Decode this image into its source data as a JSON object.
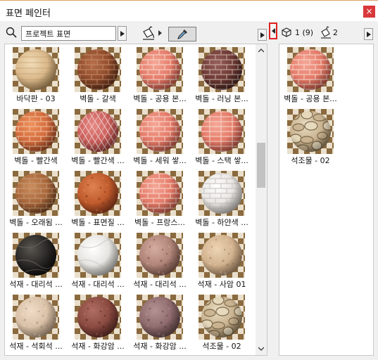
{
  "window": {
    "title": "표면 페인터",
    "close_glyph": "×"
  },
  "search": {
    "value": "프로젝트 표면",
    "placeholder": ""
  },
  "icons": {
    "search": "search-icon",
    "paint_bucket": "paint-bucket-icon",
    "eyedropper": "eyedropper-icon",
    "cube": "cube-icon",
    "close": "close-icon"
  },
  "right_toolbar": {
    "surface_count": "1 (9)",
    "paint_count": "2"
  },
  "surfaces": [
    {
      "label": "바닥판 - 03",
      "kind": "wood"
    },
    {
      "label": "벽돌 - 갈색",
      "kind": "brick_brown"
    },
    {
      "label": "벽돌 - 공용 본...",
      "kind": "brick_salmon"
    },
    {
      "label": "벽돌 - 러닝 본...",
      "kind": "brick_dark"
    },
    {
      "label": "벽돌 - 빨간색",
      "kind": "brick_orange"
    },
    {
      "label": "벽돌 - 빨간색 ...",
      "kind": "brick_herring"
    },
    {
      "label": "벽돌 - 세워 쌓...",
      "kind": "brick_salmon"
    },
    {
      "label": "벽돌 - 스택 쌓...",
      "kind": "brick_stack"
    },
    {
      "label": "벽돌 - 오래됨 ...",
      "kind": "brick_old"
    },
    {
      "label": "벽돌 - 표면질 ...",
      "kind": "brick_rough"
    },
    {
      "label": "벽돌 - 프랑스...",
      "kind": "brick_salmon"
    },
    {
      "label": "벽돌 - 하얀색 ...",
      "kind": "brick_white"
    },
    {
      "label": "석재 - 대리석 ...",
      "kind": "marble_black"
    },
    {
      "label": "석재 - 대리석 ...",
      "kind": "marble_white"
    },
    {
      "label": "석재 - 대리석 ...",
      "kind": "marble_pink"
    },
    {
      "label": "석재 - 사암 01",
      "kind": "sandstone"
    },
    {
      "label": "석재 - 석회석 ...",
      "kind": "limestone"
    },
    {
      "label": "석재 - 화강암 ...",
      "kind": "granite_red"
    },
    {
      "label": "석재 - 화강암 ...",
      "kind": "granite_pink"
    },
    {
      "label": "석조물 - 02",
      "kind": "masonry"
    }
  ],
  "used_surfaces": [
    {
      "label": "벽돌 - 공용 본...",
      "kind": "brick_salmon"
    },
    {
      "label": "석조물 - 02",
      "kind": "masonry"
    }
  ],
  "colors": {
    "close_button": "#d9383a",
    "splitter_highlight": "#e02020"
  }
}
